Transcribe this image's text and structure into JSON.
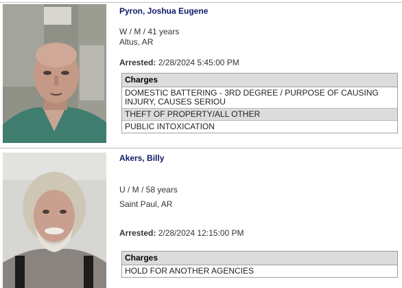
{
  "records": [
    {
      "name": "Pyron, Joshua Eugene",
      "demographics": "W / M / 41 years",
      "location": "Altus, AR",
      "arrested_label": "Arrested:",
      "arrested_value": "2/28/2024 5:45:00 PM",
      "charges_header": "Charges",
      "charges": [
        "DOMESTIC BATTERING - 3RD DEGREE / PURPOSE OF CAUSING INJURY, CAUSES SERIOU",
        "THEFT OF PROPERTY/ALL OTHER",
        "PUBLIC INTOXICATION"
      ]
    },
    {
      "name": "Akers, Billy",
      "demographics": "U / M / 58 years",
      "location": "Saint Paul, AR",
      "arrested_label": "Arrested:",
      "arrested_value": "2/28/2024 12:15:00 PM",
      "charges_header": "Charges",
      "charges": [
        "HOLD FOR ANOTHER AGENCIES"
      ]
    }
  ]
}
